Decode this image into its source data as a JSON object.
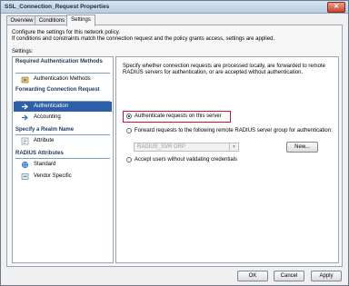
{
  "window": {
    "title": "SSL_Connection_Request Properties",
    "close_glyph": "✕"
  },
  "tabs": [
    {
      "label": "Overview"
    },
    {
      "label": "Conditions"
    },
    {
      "label": "Settings"
    }
  ],
  "panel": {
    "description": "Configure the settings for this network policy.\nIf conditions and constraints match the connection request and the policy grants access, settings are applied.",
    "settings_label": "Settings:"
  },
  "left_nav": {
    "sections": [
      {
        "heading": "Required Authentication Methods",
        "items": [
          {
            "label": "Authentication Methods",
            "icon": "auth-methods-icon"
          }
        ]
      },
      {
        "heading": "Forwarding Connection Request",
        "items": [
          {
            "label": "Authentication",
            "icon": "arrow-right-icon",
            "selected": true
          },
          {
            "label": "Accounting",
            "icon": "accounting-icon"
          }
        ]
      },
      {
        "heading": "Specify a Realm Name",
        "items": [
          {
            "label": "Attribute",
            "icon": "attribute-icon"
          }
        ]
      },
      {
        "heading": "RADIUS Attributes",
        "items": [
          {
            "label": "Standard",
            "icon": "standard-icon"
          },
          {
            "label": "Vendor Specific",
            "icon": "vendor-specific-icon"
          }
        ]
      }
    ]
  },
  "right_pane": {
    "description": "Specify whether connection requests are processed locally, are forwarded to remote RADIUS servers for authentication, or are accepted without authentication.",
    "options": [
      {
        "label": "Authenticate requests on this server",
        "selected": true
      },
      {
        "label": "Forward requests to the following remote RADIUS server group for authentication:",
        "selected": false
      },
      {
        "label": "Accept users without validating credentials",
        "selected": false
      }
    ],
    "server_group": {
      "value": "RADIUS_SVR GRP",
      "disabled": true
    },
    "new_button": "New..."
  },
  "footer": {
    "ok": "OK",
    "cancel": "Cancel",
    "apply": "Apply"
  },
  "colors": {
    "highlight": "#d2122e",
    "selection": "#2f5fa8",
    "section_heading": "#1e395b"
  }
}
